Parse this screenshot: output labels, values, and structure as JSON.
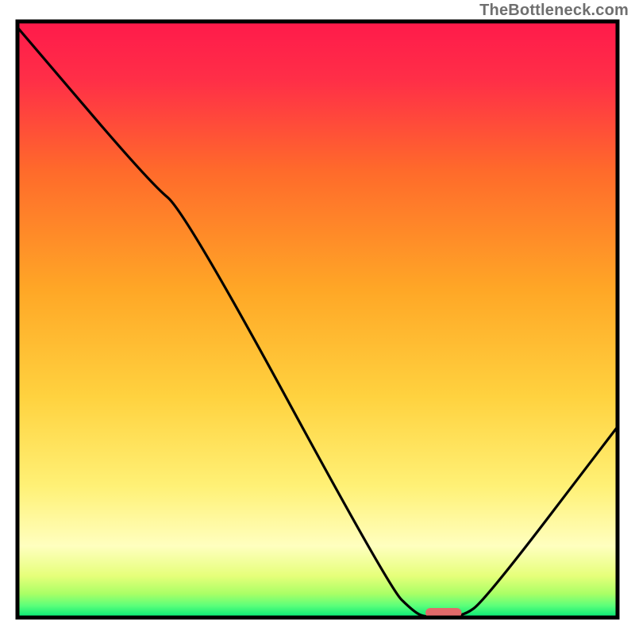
{
  "attribution": "TheBottleneck.com",
  "chart_data": {
    "type": "line",
    "title": "",
    "xlabel": "",
    "ylabel": "",
    "xlim": [
      0,
      100
    ],
    "ylim": [
      0,
      100
    ],
    "grid": false,
    "legend": false,
    "gradient_stops": [
      {
        "y": 0,
        "color": "#ff1744"
      },
      {
        "y": 30,
        "color": "#ff6a2b"
      },
      {
        "y": 55,
        "color": "#ffc awarded"
      },
      {
        "y": 75,
        "color": "#fff176"
      },
      {
        "y": 90,
        "color": "#ffffbf"
      },
      {
        "y": 95,
        "color": "#e6ff7a"
      },
      {
        "y": 98,
        "color": "#8cff8c"
      },
      {
        "y": 100,
        "color": "#00e676"
      }
    ],
    "curve": [
      {
        "x": 0,
        "y": 99
      },
      {
        "x": 22,
        "y": 73
      },
      {
        "x": 28,
        "y": 68
      },
      {
        "x": 62,
        "y": 5
      },
      {
        "x": 66,
        "y": 1
      },
      {
        "x": 68,
        "y": 0
      },
      {
        "x": 74,
        "y": 0
      },
      {
        "x": 78,
        "y": 3
      },
      {
        "x": 100,
        "y": 32
      }
    ],
    "marker": {
      "x": 71,
      "y": 0.8,
      "width_pct": 6,
      "height_pct": 1.6,
      "fill": "#e26a6a"
    },
    "frame": {
      "stroke": "#000000",
      "width": 5
    }
  }
}
